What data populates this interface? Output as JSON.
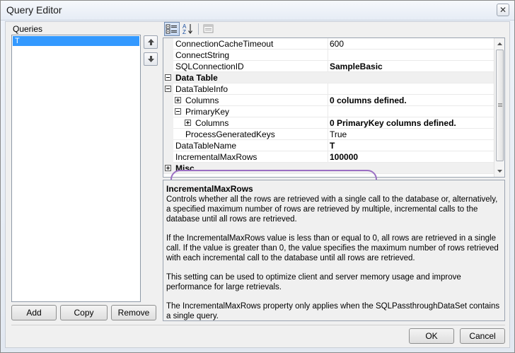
{
  "window": {
    "title": "Query Editor",
    "close_glyph": "✕"
  },
  "queries": {
    "label": "Queries",
    "items": [
      "T"
    ],
    "buttons": {
      "add": "Add",
      "copy": "Copy",
      "remove": "Remove"
    }
  },
  "toolbar": {
    "icons": [
      "categorized-icon",
      "alphabetical-icon",
      "property-pages-icon"
    ]
  },
  "properties": [
    {
      "name": "ConnectionCacheTimeout",
      "value": "600"
    },
    {
      "name": "ConnectString",
      "value": ""
    },
    {
      "name": "SQLConnectionID",
      "value": "SampleBasic"
    },
    {
      "name": "Data Table",
      "value": ""
    },
    {
      "name": "DataTableInfo",
      "value": ""
    },
    {
      "name": "Columns",
      "value": "0 columns defined."
    },
    {
      "name": "PrimaryKey",
      "value": ""
    },
    {
      "name": "Columns",
      "value": "0 PrimaryKey columns defined."
    },
    {
      "name": "ProcessGeneratedKeys",
      "value": "True"
    },
    {
      "name": "DataTableName",
      "value": "T"
    },
    {
      "name": "IncrementalMaxRows",
      "value": "100000"
    },
    {
      "name": "Misc",
      "value": ""
    }
  ],
  "description": {
    "title": "IncrementalMaxRows",
    "paragraphs": [
      "Controls whether all the rows are retrieved with a single call to the database or, alternatively, a specified maximum number of rows are retrieved by multiple, incremental calls to the database until all rows are retrieved.",
      "If the IncrementalMaxRows value is less than or equal to 0, all rows are retrieved in a single call.  If the value is greater than 0, the value specifies the maximum number of rows retrieved with each incremental call to the database until all rows are retrieved.",
      "This setting can be used to optimize client and server memory usage and improve performance for large retrievals.",
      "The IncrementalMaxRows property only applies when the SQLPassthroughDataSet contains a single query."
    ]
  },
  "footer": {
    "ok": "OK",
    "cancel": "Cancel"
  },
  "colors": {
    "selection": "#3399ff",
    "highlight_ring": "#9b6fc3"
  }
}
